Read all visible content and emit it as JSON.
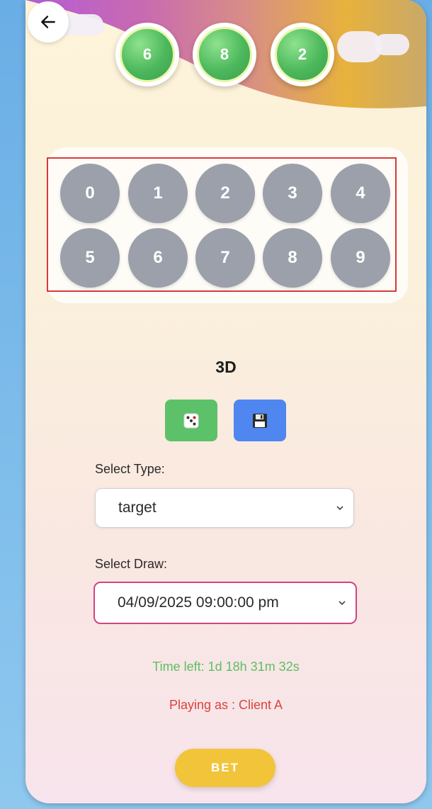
{
  "header": {
    "result_balls": [
      "6",
      "8",
      "2"
    ]
  },
  "picker": {
    "numbers": [
      "0",
      "1",
      "2",
      "3",
      "4",
      "5",
      "6",
      "7",
      "8",
      "9"
    ]
  },
  "game": {
    "title": "3D",
    "random_icon": "dice-icon",
    "save_icon": "floppy-disk-icon"
  },
  "form": {
    "type_label": "Select Type:",
    "type_value": "target",
    "draw_label": "Select Draw:",
    "draw_value": "04/09/2025 09:00:00 pm"
  },
  "status": {
    "time_left": "Time left: 1d 18h 31m 32s",
    "playing_as": "Playing as : Client A"
  },
  "actions": {
    "bet_label": "BET"
  },
  "colors": {
    "ball_green": "#4cb85c",
    "number_grey": "#9ba0aa",
    "random_button": "#5cc169",
    "save_button": "#4f86ef",
    "time_text": "#5cbf62",
    "player_text": "#d9443c",
    "bet_button": "#f2c43a",
    "draw_border": "#d0457f"
  }
}
